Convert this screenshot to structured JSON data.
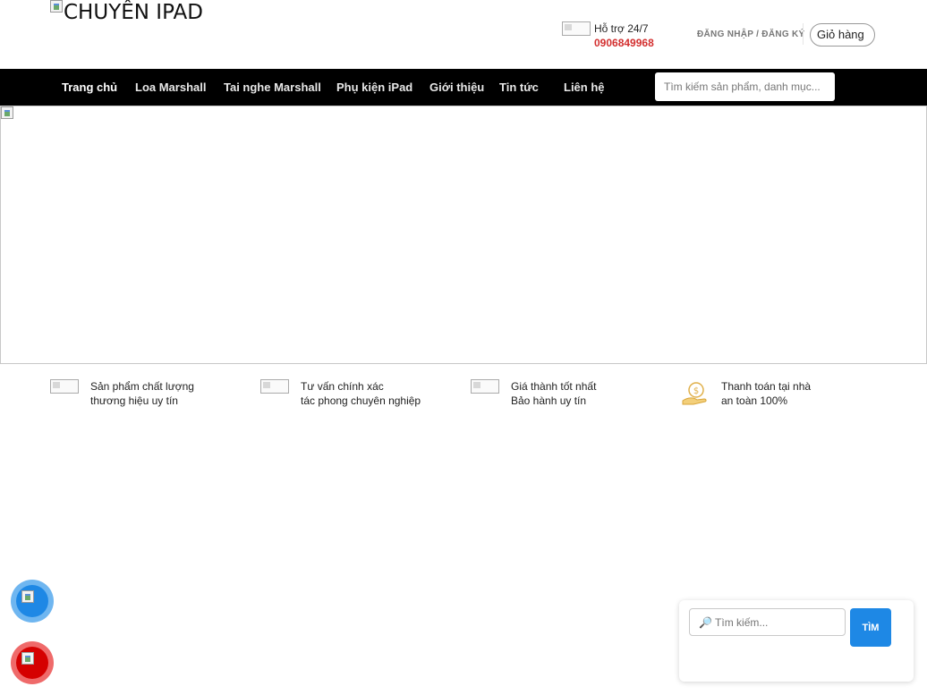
{
  "header": {
    "logo_alt": "CHUYÊN IPAD",
    "support_label": "Hỗ trợ 24/7",
    "support_phone": "0906849968",
    "auth_link": "ĐĂNG NHẬP / ĐĂNG KÝ",
    "cart_label": "Giỏ hàng"
  },
  "nav": {
    "items": [
      {
        "label": "Trang chủ",
        "active": true
      },
      {
        "label": "Loa Marshall"
      },
      {
        "label": "Tai nghe Marshall"
      },
      {
        "label": "Phụ kiện iPad"
      },
      {
        "label": "Giới thiệu"
      },
      {
        "label": "Tin tức"
      },
      {
        "label": "Liên hệ"
      }
    ],
    "search_placeholder": "Tìm kiếm sản phẩm, danh mục..."
  },
  "features": [
    {
      "line1": "Sản phẩm chất lượng",
      "line2": "thương hiệu uy tín",
      "icon": "image-icon"
    },
    {
      "line1": "Tư vấn chính xác",
      "line2": "tác phong chuyên nghiệp",
      "icon": "image-icon"
    },
    {
      "line1": "Giá thành tốt nhất",
      "line2": "Bảo hành uy tín",
      "icon": "image-icon"
    },
    {
      "line1": "Thanh toán tại nhà",
      "line2": "an toàn 100%",
      "icon": "coin-hand-icon"
    }
  ],
  "floating": {
    "blue_icon": "messenger-icon",
    "red_icon": "phone-icon"
  },
  "search_widget": {
    "placeholder": "Tìm kiếm...",
    "button_label": "TÌM"
  },
  "colors": {
    "nav_bg": "#000000",
    "phone": "#d32f2f",
    "primary_blue": "#1e88e5",
    "red": "#d50000"
  }
}
